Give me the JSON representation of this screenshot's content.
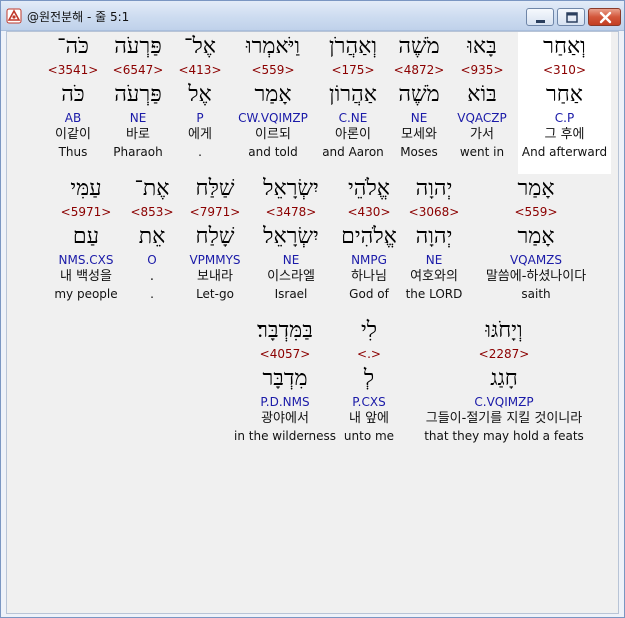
{
  "window": {
    "title": "@원전분해 - 줄 5:1"
  },
  "rows": [
    [
      {
        "heb": "וְאַחַר",
        "strong": "<310>",
        "lemma": "אַחַר",
        "parse": "C.P",
        "kor": "그 후에",
        "eng": "And afterward",
        "highlight": true
      },
      {
        "heb": "בָּאוּ",
        "strong": "<935>",
        "lemma": "בּוֹא",
        "parse": "VQACZP",
        "kor": "가서",
        "eng": "went in"
      },
      {
        "heb": "מֹשֶׁה",
        "strong": "<4872>",
        "lemma": "מֹשֶׁה",
        "parse": "NE",
        "kor": "모세와",
        "eng": "Moses"
      },
      {
        "heb": "וְאַהֲרֹן",
        "strong": "<175>",
        "lemma": "אַהֲרוֹן",
        "parse": "C.NE",
        "kor": "아론이",
        "eng": "and Aaron"
      },
      {
        "heb": "וַיֹּאמְרוּ",
        "strong": "<559>",
        "lemma": "אָמַר",
        "parse": "CW.VQIMZP",
        "kor": "이르되",
        "eng": "and told"
      },
      {
        "heb": "אֶל־",
        "strong": "<413>",
        "lemma": "אֶל",
        "parse": "P",
        "kor": "에게",
        "eng": "."
      },
      {
        "heb": "פַּרְעֹה",
        "strong": "<6547>",
        "lemma": "פַּרְעֹה",
        "parse": "NE",
        "kor": "바로",
        "eng": "Pharaoh"
      },
      {
        "heb": "כֹּה־",
        "strong": "<3541>",
        "lemma": "כֹּה",
        "parse": "AB",
        "kor": "이같이",
        "eng": "Thus"
      }
    ],
    [
      {
        "heb": "אָמַר",
        "strong": "<559>",
        "lemma": "אָמַר",
        "parse": "VQAMZS",
        "kor": "말씀에-하셨나이다",
        "eng": "saith"
      },
      {
        "heb": "יְהוָה",
        "strong": "<3068>",
        "lemma": "יְהוָה",
        "parse": "NE",
        "kor": "여호와의",
        "eng": "the LORD"
      },
      {
        "heb": "אֱלֹהֵי",
        "strong": "<430>",
        "lemma": "אֱלֹהִים",
        "parse": "NMPG",
        "kor": "하나님",
        "eng": "God of"
      },
      {
        "heb": "יִשְׂרָאֵל",
        "strong": "<3478>",
        "lemma": "יִשְׂרָאֵל",
        "parse": "NE",
        "kor": "이스라엘",
        "eng": "Israel"
      },
      {
        "heb": "שַׁלַּח",
        "strong": "<7971>",
        "lemma": "שָׁלַח",
        "parse": "VPMMYS",
        "kor": "보내라",
        "eng": "Let-go"
      },
      {
        "heb": "אֶת־",
        "strong": "<853>",
        "lemma": "אֵת",
        "parse": "O",
        "kor": ".",
        "eng": "."
      },
      {
        "heb": "עַמִּי",
        "strong": "<5971>",
        "lemma": "עַם",
        "parse": "NMS.CXS",
        "kor": "내 백성을",
        "eng": "my people"
      }
    ],
    [
      {
        "heb": "וְיָחֹגּוּ",
        "strong": "<2287>",
        "lemma": "חָגַג",
        "parse": "C.VQIMZP",
        "kor": "그들이-절기를 지킬 것이니라",
        "eng": "that they may hold a feats"
      },
      {
        "heb": "לִי",
        "strong": "<.>",
        "lemma": "לְ",
        "parse": "P.CXS",
        "kor": "내 앞에",
        "eng": "unto me"
      },
      {
        "heb": "בַּמִּדְבָּר׃",
        "strong": "<4057>",
        "lemma": "מִדְבָּר",
        "parse": "P.D.NMS",
        "kor": "광야에서",
        "eng": "in the wilderness"
      }
    ]
  ]
}
